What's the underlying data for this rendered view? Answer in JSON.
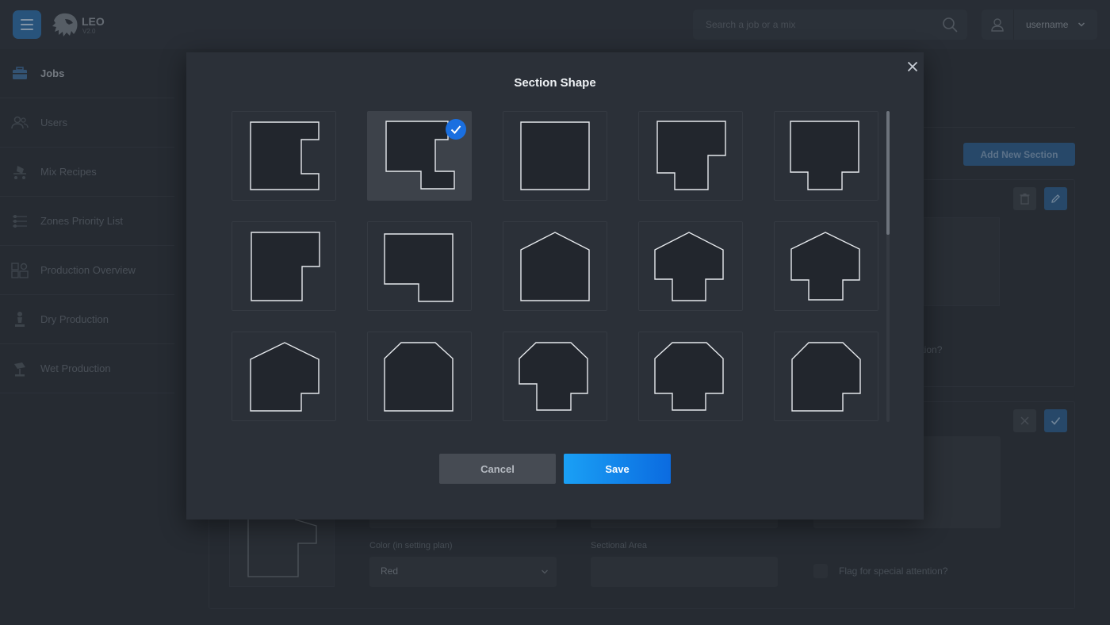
{
  "app": {
    "brand": "LEO",
    "version": "V2.0"
  },
  "search": {
    "placeholder": "Search a job or a mix"
  },
  "user": {
    "name": "username"
  },
  "sidebar": {
    "items": [
      {
        "label": "Jobs",
        "icon": "briefcase-icon",
        "active": true
      },
      {
        "label": "Users",
        "icon": "users-icon",
        "active": false
      },
      {
        "label": "Mix Recipes",
        "icon": "mixer-icon",
        "active": false
      },
      {
        "label": "Zones Priority List",
        "icon": "sliders-icon",
        "active": false
      },
      {
        "label": "Production Overview",
        "icon": "production-overview-icon",
        "active": false
      },
      {
        "label": "Dry Production",
        "icon": "dry-production-icon",
        "active": false
      },
      {
        "label": "Wet Production",
        "icon": "wet-production-icon",
        "active": false
      }
    ]
  },
  "page": {
    "add_section_label": "Add New Section",
    "card1": {
      "flag_label_partial": "ention?"
    },
    "card2": {
      "color_label": "Color (in setting plan)",
      "color_value": "Red",
      "area_label": "Sectional Area",
      "area_value": "",
      "flag_label": "Flag for special attention?"
    }
  },
  "modal": {
    "title": "Section Shape",
    "cancel_label": "Cancel",
    "save_label": "Save",
    "selected_index": 1,
    "shapes": [
      "notch-right",
      "l-step-right",
      "square",
      "t-bottom-right-offset",
      "t-bottom-center",
      "l-corner-right",
      "l-corner-bottom",
      "house",
      "house-wings-offset",
      "house-wings",
      "house-notch",
      "octagon-top",
      "octagon-wings-offset",
      "octagon-wings",
      "octagon-notch"
    ]
  },
  "colors": {
    "accent": "#1a8cf0",
    "selected_check": "#1a6fe0",
    "page_bg": "#2b3038"
  }
}
